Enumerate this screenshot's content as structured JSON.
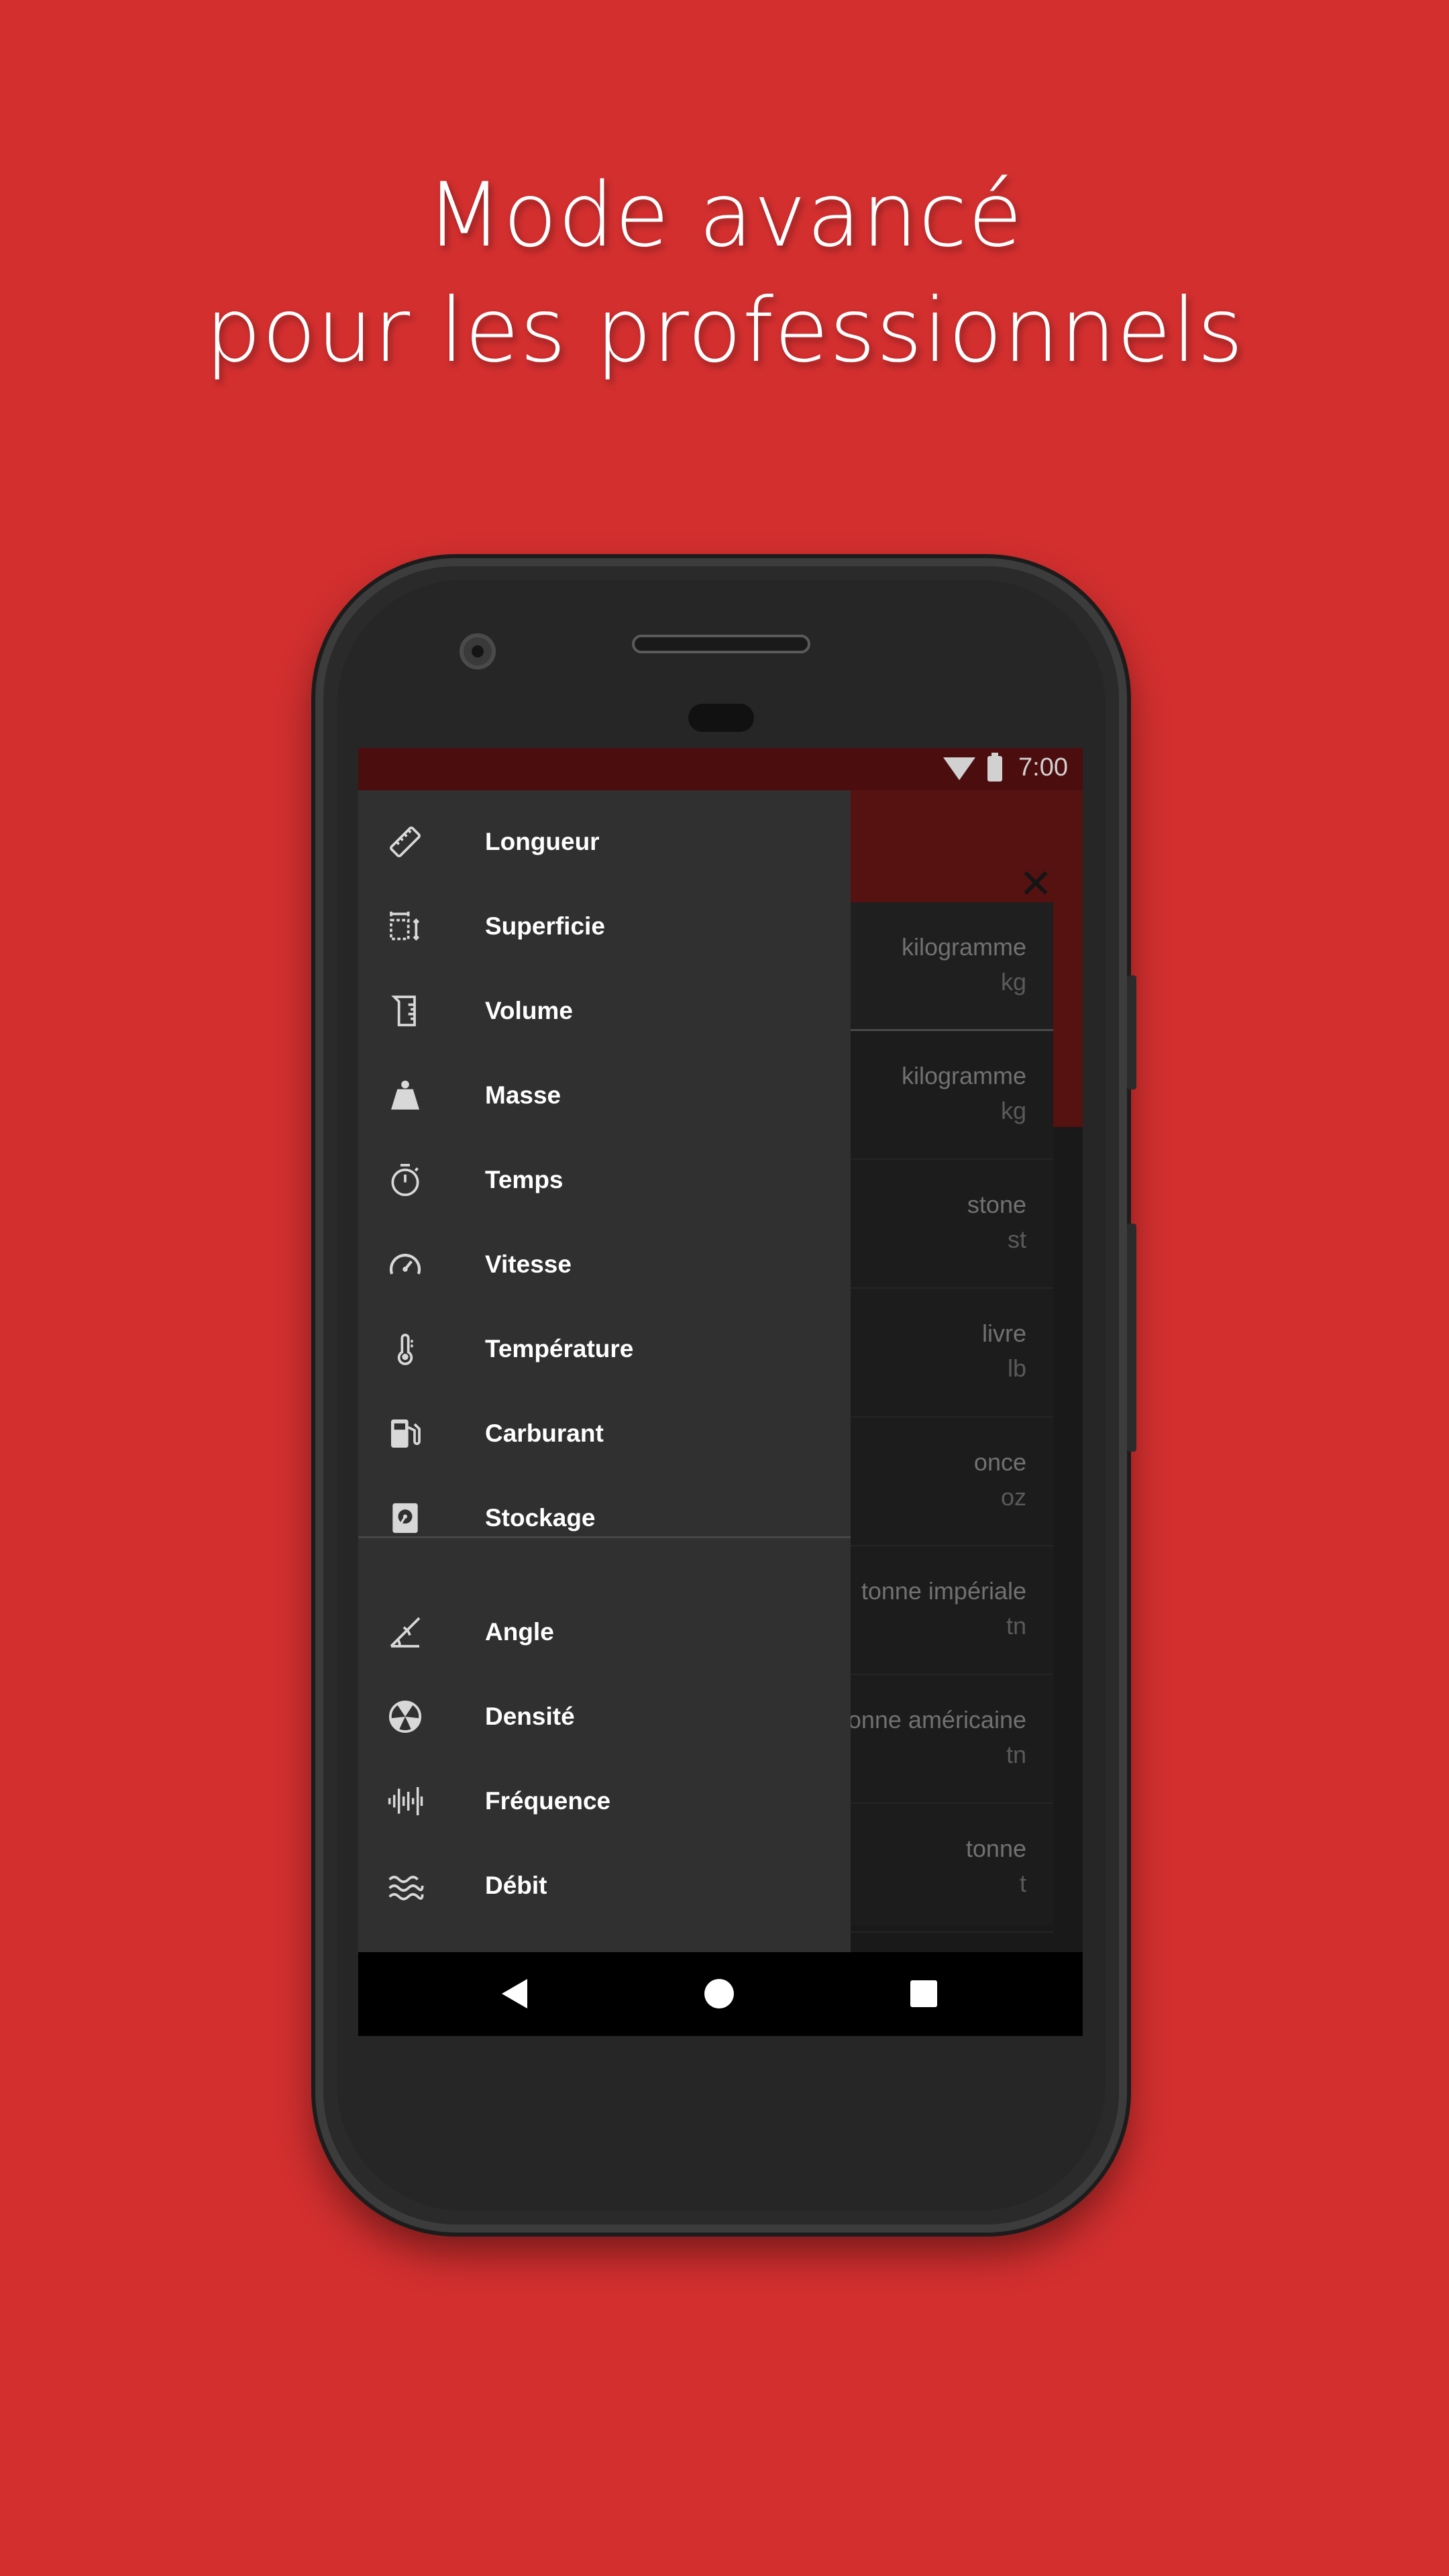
{
  "headline": {
    "line1": "Mode avancé",
    "line2": "pour les professionnels"
  },
  "colors": {
    "background": "#d32f2f",
    "status_bar": "#5c1010",
    "app_bar": "#6a1515",
    "drawer": "#303030"
  },
  "status_bar": {
    "time": "7:00",
    "icons": [
      "wifi-icon",
      "battery-icon"
    ]
  },
  "app_bar": {
    "close_icon": "close-icon"
  },
  "units": [
    {
      "name": "kilogramme",
      "symbol": "kg"
    },
    {
      "name": "kilogramme",
      "symbol": "kg"
    },
    {
      "name": "stone",
      "symbol": "st"
    },
    {
      "name": "livre",
      "symbol": "lb"
    },
    {
      "name": "once",
      "symbol": "oz"
    },
    {
      "name": "tonne impériale",
      "symbol": "tn"
    },
    {
      "name": "tonne américaine",
      "symbol": "tn"
    },
    {
      "name": "tonne",
      "symbol": "t"
    }
  ],
  "drawer": {
    "items": [
      {
        "label": "Longueur",
        "icon": "ruler-icon"
      },
      {
        "label": "Superficie",
        "icon": "area-icon"
      },
      {
        "label": "Volume",
        "icon": "beaker-icon"
      },
      {
        "label": "Masse",
        "icon": "weight-icon"
      },
      {
        "label": "Temps",
        "icon": "stopwatch-icon"
      },
      {
        "label": "Vitesse",
        "icon": "speedometer-icon"
      },
      {
        "label": "Température",
        "icon": "thermometer-icon"
      },
      {
        "label": "Carburant",
        "icon": "fuel-icon"
      },
      {
        "label": "Stockage",
        "icon": "harddisk-icon"
      }
    ],
    "extra_items": [
      {
        "label": "Angle",
        "icon": "angle-icon"
      },
      {
        "label": "Densité",
        "icon": "density-icon"
      },
      {
        "label": "Fréquence",
        "icon": "frequency-icon"
      },
      {
        "label": "Débit",
        "icon": "flow-icon"
      }
    ]
  },
  "nav_bar": {
    "buttons": [
      "back-icon",
      "home-icon",
      "recents-icon"
    ]
  }
}
